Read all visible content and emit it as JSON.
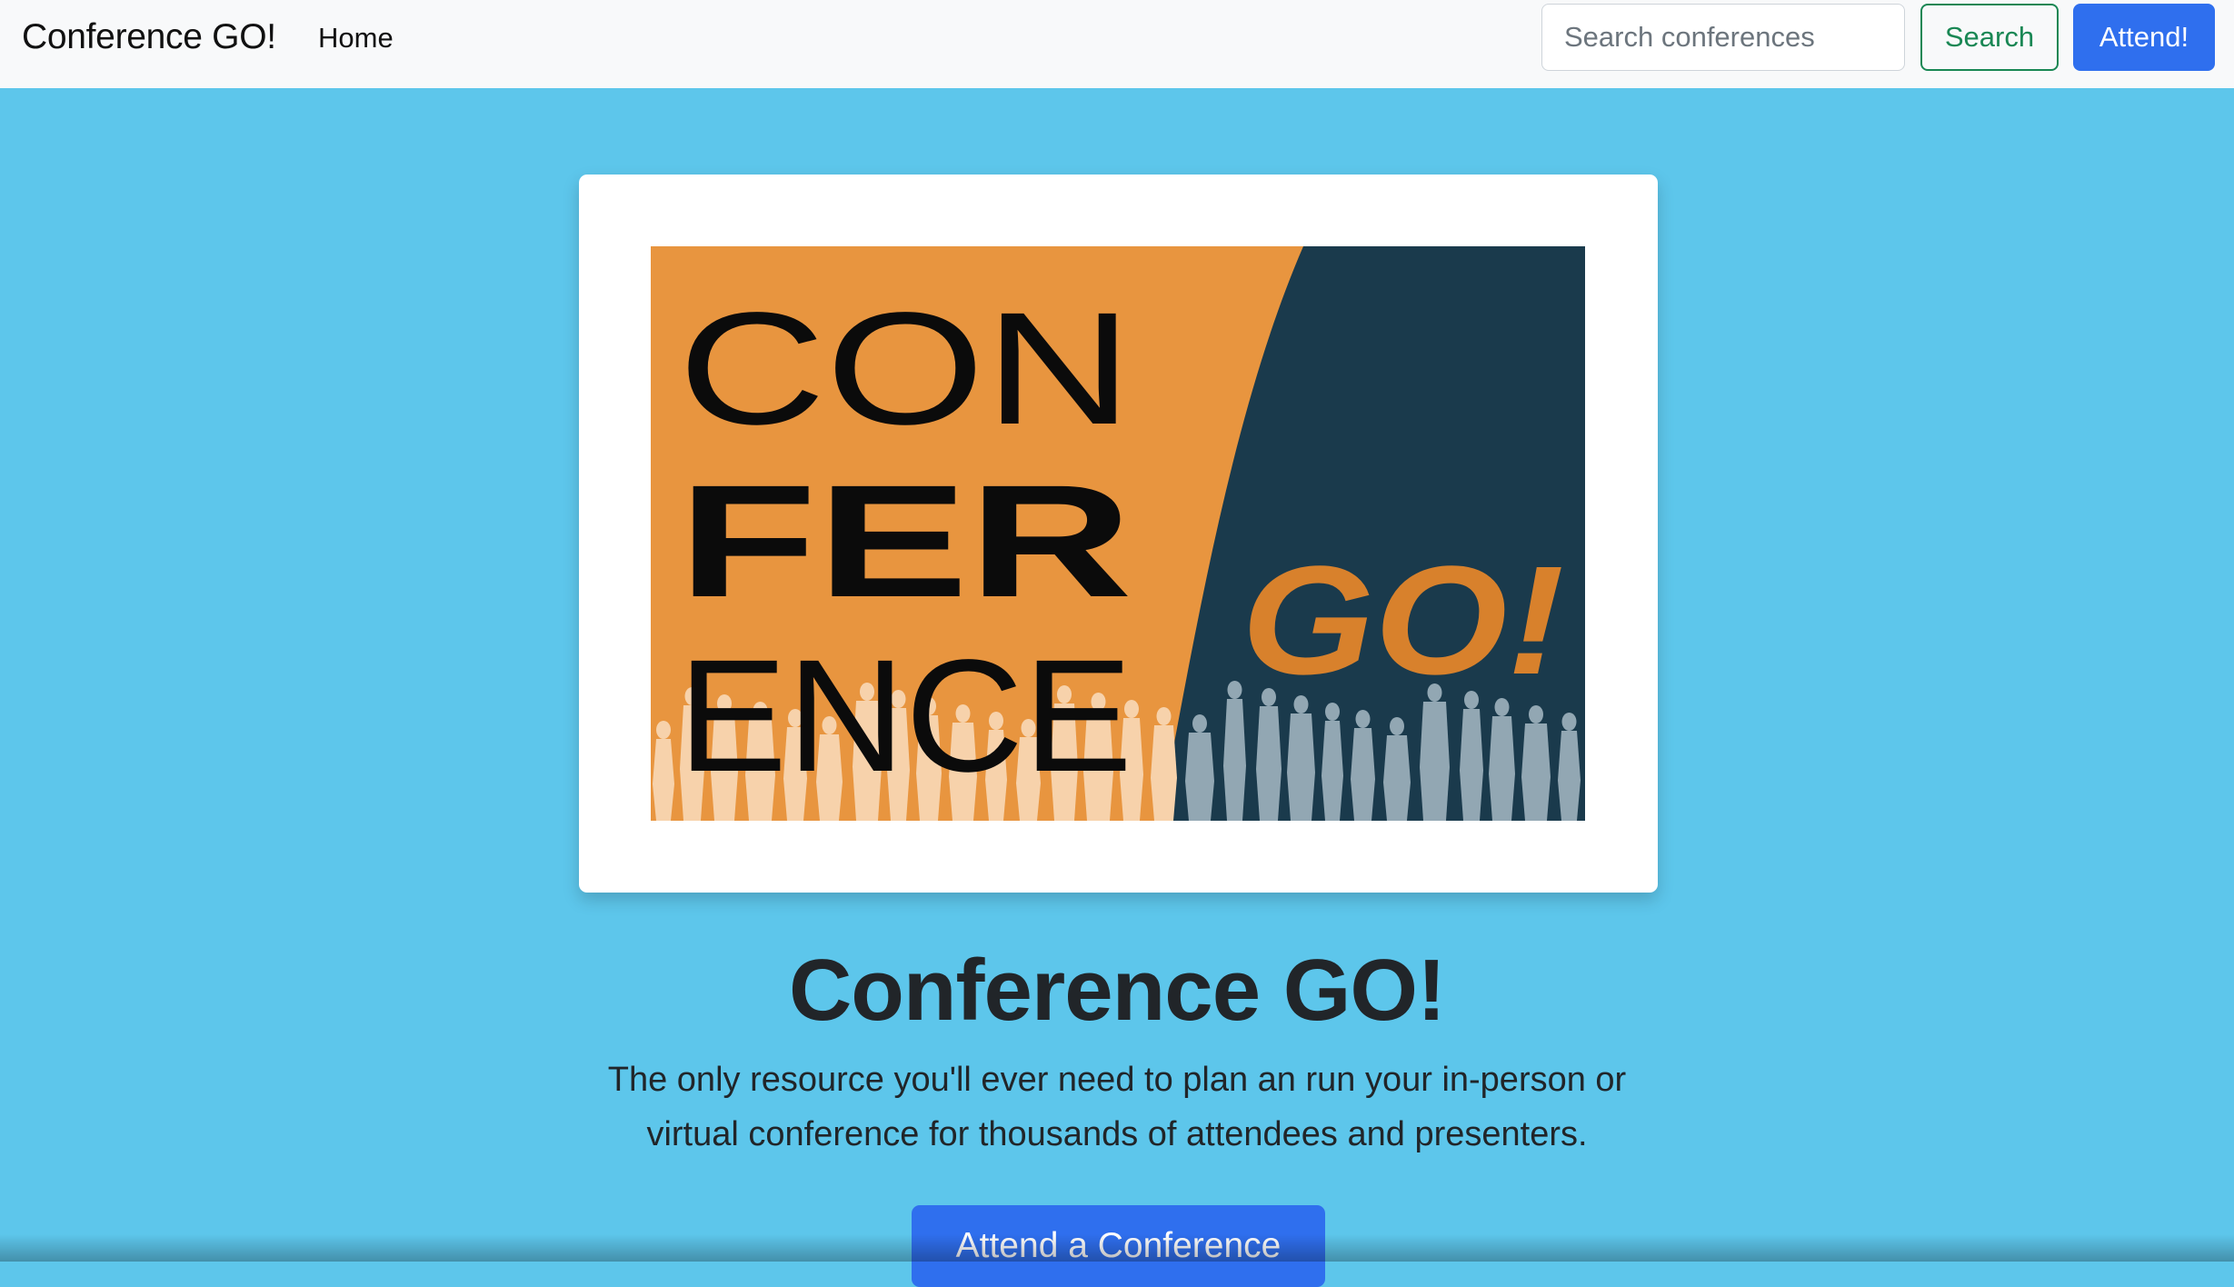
{
  "navbar": {
    "brand": "Conference GO!",
    "links": [
      {
        "label": "Home"
      }
    ],
    "search": {
      "placeholder": "Search conferences",
      "value": ""
    },
    "search_button": "Search",
    "attend_button": "Attend!"
  },
  "hero": {
    "logo": {
      "line1": "CON",
      "line2": "FER",
      "line3": "ENCE",
      "go": "GO!",
      "colors": {
        "orange": "#e8953f",
        "navy": "#1a3a4c",
        "go": "#d8812c",
        "crowd_light": "#f7d2ab",
        "crowd_dark": "#92a7b3"
      }
    },
    "title": "Conference GO!",
    "lead": "The only resource you'll ever need to plan an run your in-person or virtual conference for thousands of attendees and presenters.",
    "cta": "Attend a Conference"
  },
  "colors": {
    "page_background": "#5dc6eb",
    "primary": "#2f6fee",
    "success": "#198754",
    "navbar": "#f8f9fa"
  }
}
